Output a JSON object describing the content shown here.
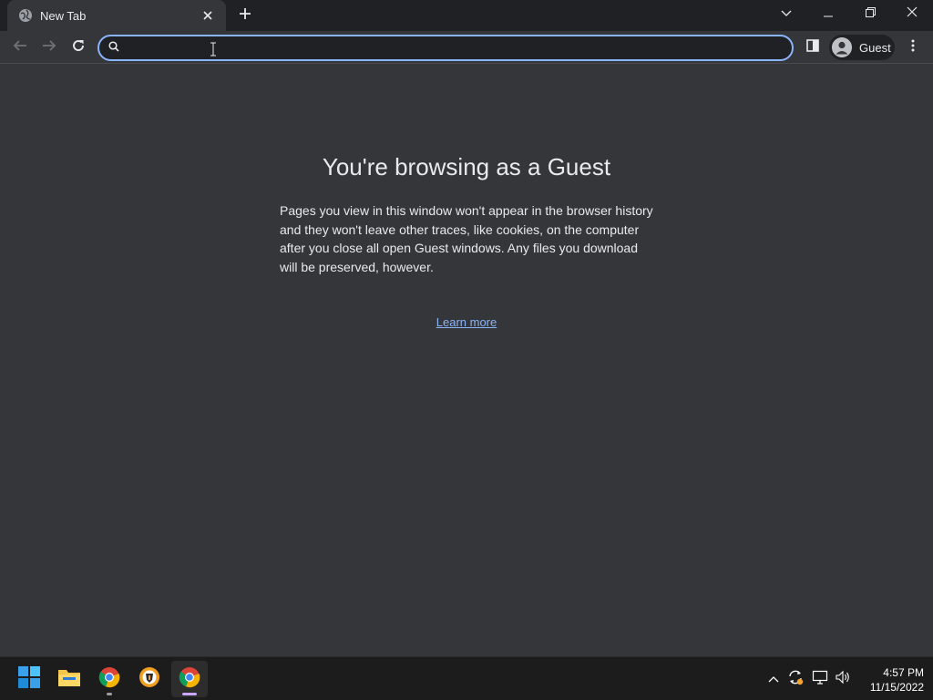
{
  "window": {
    "tab": {
      "title": "New Tab",
      "favicon": "globe-icon",
      "close_icon": "close-icon"
    },
    "new_tab_icon": "plus-icon",
    "controls": [
      "chevron-down-icon",
      "minimize-icon",
      "restore-icon",
      "close-icon"
    ]
  },
  "toolbar": {
    "back_icon": "arrow-left-icon",
    "forward_icon": "arrow-right-icon",
    "reload_icon": "reload-icon",
    "omnibox": {
      "value": "",
      "placeholder": "",
      "icon": "search-icon"
    },
    "side_panel_icon": "side-panel-icon",
    "profile": {
      "label": "Guest",
      "icon": "person-icon"
    },
    "menu_icon": "more-vert-icon"
  },
  "page": {
    "heading": "You're browsing as a Guest",
    "body": "Pages you view in this window won't appear in the browser history and they won't leave other traces, like cookies, on the computer after you close all open Guest windows. Any files you download will be preserved, however.",
    "link": "Learn more"
  },
  "taskbar": {
    "apps": [
      {
        "name": "start",
        "icon": "windows-icon"
      },
      {
        "name": "file-explorer",
        "icon": "folder-icon"
      },
      {
        "name": "chrome",
        "icon": "chrome-icon",
        "running": true
      },
      {
        "name": "brave",
        "icon": "brave-icon"
      },
      {
        "name": "chrome-guest",
        "icon": "chrome-icon",
        "active": true
      }
    ],
    "tray": [
      "chevron-up-icon",
      "sync-icon",
      "network-icon",
      "volume-icon"
    ],
    "clock": {
      "time": "4:57 PM",
      "date": "11/15/2022"
    }
  },
  "colors": {
    "window_bg": "#35363a",
    "titlebar_bg": "#202124",
    "accent": "#8ab4f8",
    "text": "#e8eaed",
    "taskbar_bg": "#1c1c1c"
  }
}
